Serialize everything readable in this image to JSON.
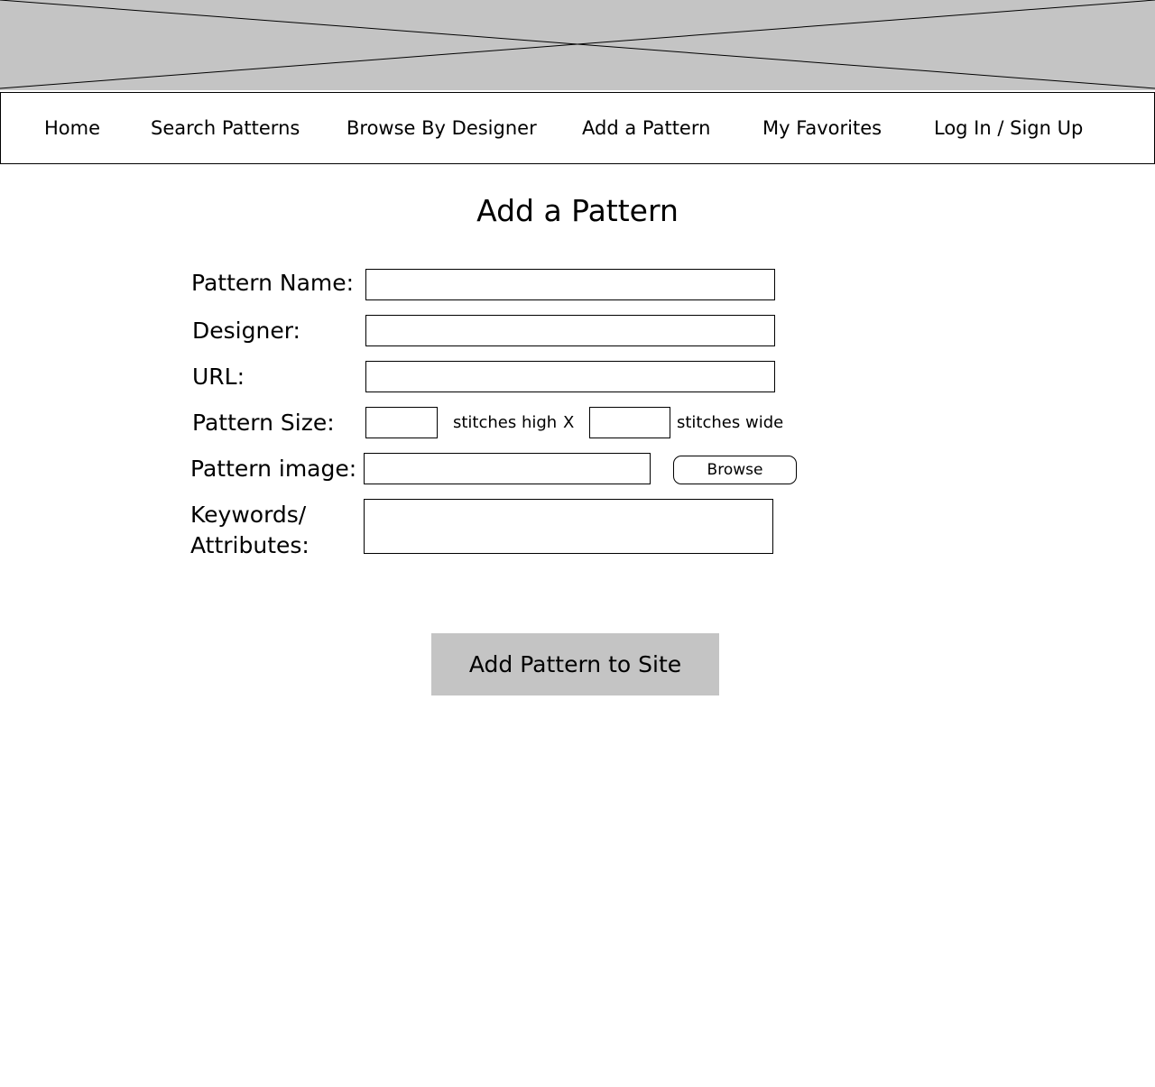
{
  "nav": {
    "items": [
      {
        "label": "Home"
      },
      {
        "label": "Search Patterns"
      },
      {
        "label": "Browse By Designer"
      },
      {
        "label": "Add a Pattern"
      },
      {
        "label": "My Favorites"
      },
      {
        "label": "Log In / Sign Up"
      }
    ]
  },
  "page": {
    "title": "Add a Pattern"
  },
  "form": {
    "pattern_name_label": "Pattern Name:",
    "pattern_name_value": "",
    "designer_label": "Designer:",
    "designer_value": "",
    "url_label": "URL:",
    "url_value": "",
    "pattern_size_label": "Pattern Size:",
    "stitches_high_value": "",
    "stitches_high_text": "stitches high",
    "times_symbol": "X",
    "stitches_wide_value": "",
    "stitches_wide_text": "stitches wide",
    "pattern_image_label": "Pattern image:",
    "pattern_image_value": "",
    "browse_label": "Browse",
    "keywords_label_line1": "Keywords/",
    "keywords_label_line2": "Attributes:",
    "keywords_value": "",
    "submit_label": "Add Pattern to Site"
  },
  "colors": {
    "placeholder_gray": "#c4c4c4",
    "border": "#000000",
    "background": "#ffffff"
  },
  "icons": {
    "banner": "image-placeholder-icon"
  }
}
